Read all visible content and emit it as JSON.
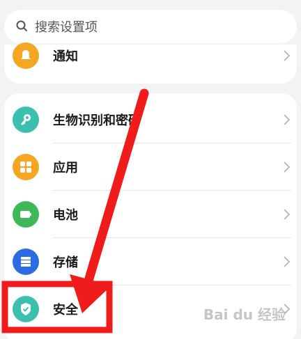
{
  "search": {
    "placeholder": "搜索设置项"
  },
  "top_item": {
    "label": "通知",
    "color": "#f5a623"
  },
  "items": [
    {
      "label": "生物识别和密码",
      "color": "#3dbfb0",
      "icon": "key-icon"
    },
    {
      "label": "应用",
      "color": "#f5a623",
      "icon": "apps-grid-icon"
    },
    {
      "label": "电池",
      "color": "#3fb957",
      "icon": "battery-icon"
    },
    {
      "label": "存储",
      "color": "#2d6be3",
      "icon": "storage-icon"
    },
    {
      "label": "安全",
      "color": "#3dbfb0",
      "icon": "shield-check-icon"
    }
  ],
  "watermark": {
    "text": "Bai du 经验"
  },
  "colors": {
    "annotation_red": "#f01c1c"
  }
}
